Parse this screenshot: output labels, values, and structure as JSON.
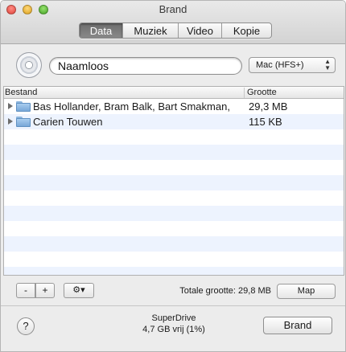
{
  "window": {
    "title": "Brand"
  },
  "tabs": [
    {
      "label": "Data",
      "active": true
    },
    {
      "label": "Muziek",
      "active": false
    },
    {
      "label": "Video",
      "active": false
    },
    {
      "label": "Kopie",
      "active": false
    }
  ],
  "disc": {
    "name_value": "Naamloos",
    "format_selected": "Mac (HFS+)"
  },
  "table": {
    "columns": {
      "name": "Bestand",
      "size": "Grootte"
    },
    "rows": [
      {
        "name": "Bas Hollander, Bram Balk, Bart Smakman,",
        "size": "29,3 MB",
        "icon": "folder-icon"
      },
      {
        "name": "Carien Touwen",
        "size": "115 KB",
        "icon": "folder-icon"
      }
    ]
  },
  "controls": {
    "minus_label": "-",
    "plus_label": "+",
    "gear_label": "⚙▾",
    "total_label": "Totale grootte: 29,8 MB",
    "map_label": "Map"
  },
  "footer": {
    "help_label": "?",
    "drive_name": "SuperDrive",
    "drive_free": "4,7 GB vrij (1%)",
    "burn_label": "Brand"
  },
  "colors": {
    "row_alt": "#edf3fe",
    "folder": "#78a8d8"
  }
}
